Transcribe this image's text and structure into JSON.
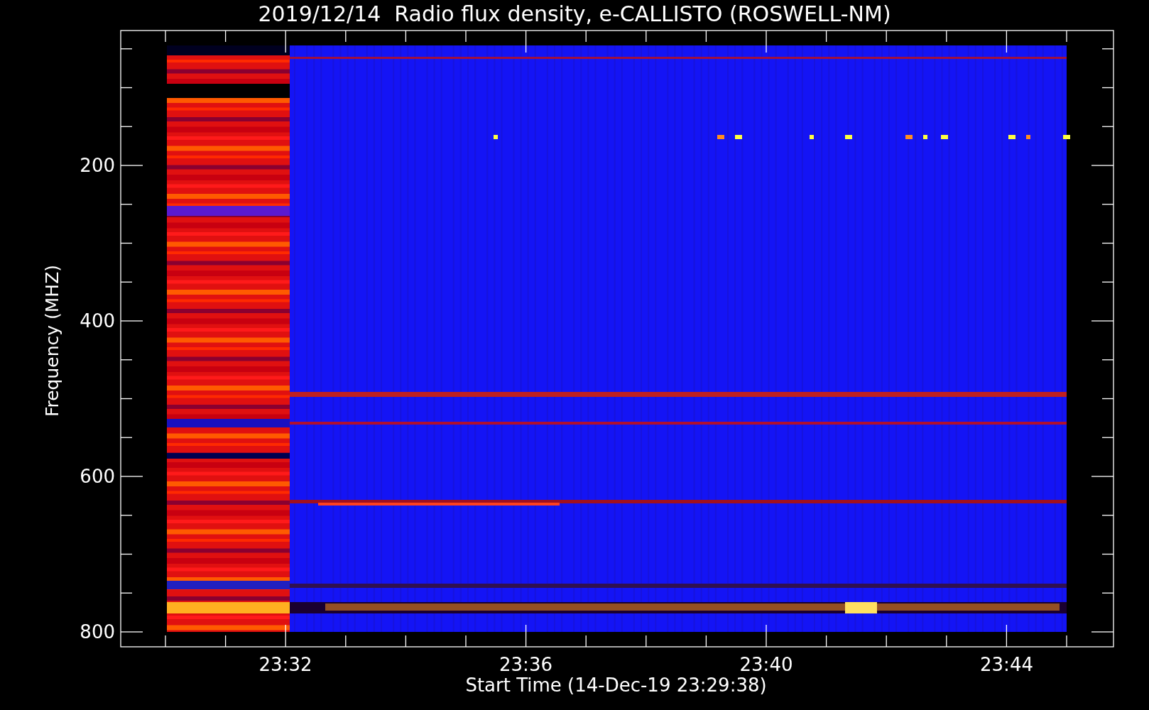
{
  "title": "2019/12/14  Radio flux density, e-CALLISTO (ROSWELL-NM)",
  "y_axis": {
    "label": "Frequency (MHZ)",
    "ticks": [
      "200",
      "400",
      "600",
      "800"
    ]
  },
  "x_axis": {
    "label": "Start Time (14-Dec-19 23:29:38)",
    "ticks": [
      "23:32",
      "23:36",
      "23:40",
      "23:44"
    ]
  }
}
